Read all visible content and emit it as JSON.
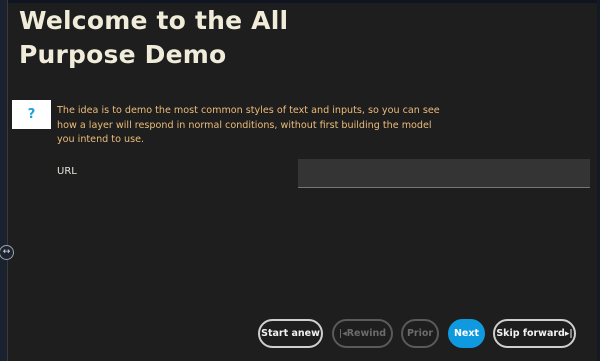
{
  "page": {
    "title": "Welcome to the All Purpose Demo",
    "help_icon": "?",
    "intro_text": "The idea is to demo the most common styles of text and inputs, so you can see how a layer will respond in normal conditions, without first building the model you intend to use."
  },
  "form": {
    "url_label": "URL",
    "url_value": "",
    "url_placeholder": ""
  },
  "handle": {
    "icon": "resize-horizontal-icon",
    "glyph": "↔"
  },
  "nav": {
    "start_anew": "Start anew",
    "rewind_glyph": "|◂",
    "rewind": "Rewind",
    "prior": "Prior",
    "next": "Next",
    "skip_forward": "Skip forward",
    "skip_glyph": "▸|"
  },
  "colors": {
    "background": "#1f1e1e",
    "title": "#f1ecd9",
    "intro_text": "#ebbc7a",
    "primary": "#0f9ae0",
    "help_icon": "#1ea0dc"
  }
}
